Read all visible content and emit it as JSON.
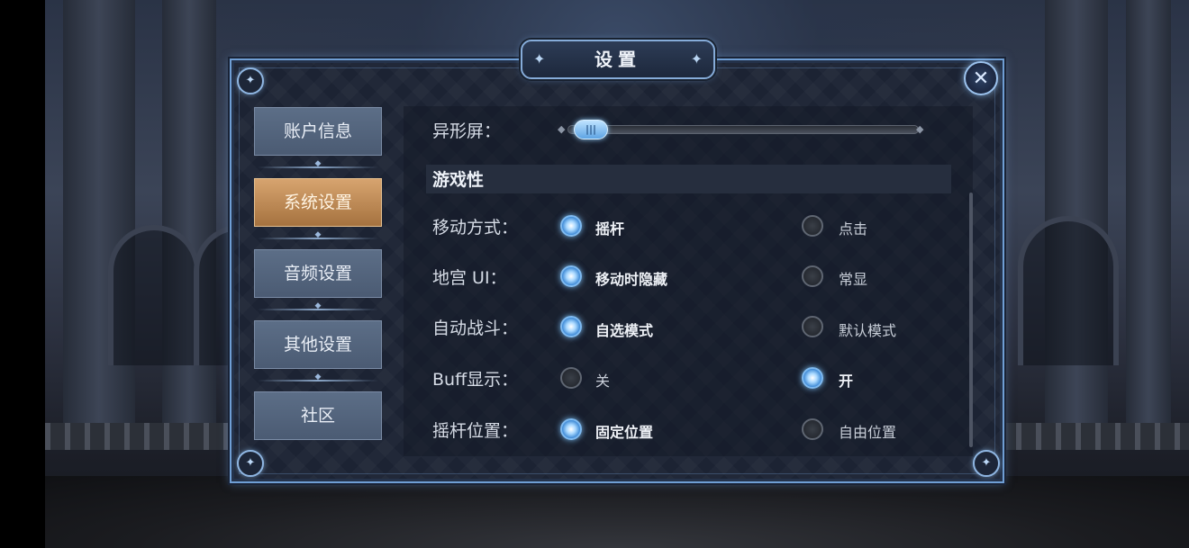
{
  "title": "设置",
  "nav": [
    {
      "label": "账户信息",
      "active": false
    },
    {
      "label": "系统设置",
      "active": true
    },
    {
      "label": "音频设置",
      "active": false
    },
    {
      "label": "其他设置",
      "active": false
    },
    {
      "label": "社区",
      "active": false
    }
  ],
  "slider": {
    "label": "异形屏：",
    "value_fraction": 0.02
  },
  "section_title": "游戏性",
  "rows": [
    {
      "label": "移动方式：",
      "options": [
        {
          "text": "摇杆",
          "selected": true
        },
        {
          "text": "点击",
          "selected": false
        }
      ]
    },
    {
      "label": "地宫  UI：",
      "options": [
        {
          "text": "移动时隐藏",
          "selected": true
        },
        {
          "text": "常显",
          "selected": false
        }
      ]
    },
    {
      "label": "自动战斗：",
      "options": [
        {
          "text": "自选模式",
          "selected": true
        },
        {
          "text": "默认模式",
          "selected": false
        }
      ]
    },
    {
      "label": "Buff显示：",
      "options": [
        {
          "text": "关",
          "selected": false
        },
        {
          "text": "开",
          "selected": true
        }
      ]
    },
    {
      "label": "摇杆位置：",
      "options": [
        {
          "text": "固定位置",
          "selected": true
        },
        {
          "text": "自由位置",
          "selected": false
        }
      ]
    }
  ],
  "icons": {
    "close": "close-x-icon",
    "corner": "corner-ornament-icon",
    "slider_handle": "slider-grip-icon"
  },
  "colors": {
    "accent_blue": "#7fbaf0",
    "active_tab": "#c48c55",
    "tab": "#546580"
  }
}
